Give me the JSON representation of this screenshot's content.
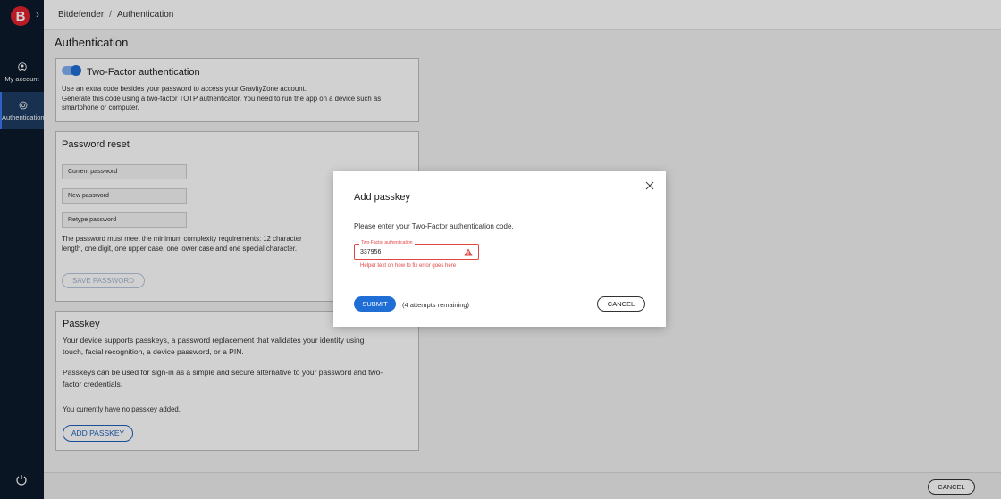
{
  "sidebar": {
    "logo_letter": "B",
    "items": [
      {
        "label": "My account",
        "icon": "user-circle-icon"
      },
      {
        "label": "Authentication",
        "icon": "target-icon"
      }
    ]
  },
  "breadcrumb": {
    "root": "Bitdefender",
    "separator": "/",
    "current": "Authentication"
  },
  "page_title": "Authentication",
  "two_factor": {
    "title": "Two-Factor authentication",
    "enabled": true,
    "line1": "Use an extra code besides your password to access your GravityZone account.",
    "line2": "Generate this code using a two-factor TOTP authenticator. You need to run the app on a device such as",
    "line3": "smartphone or computer."
  },
  "password_reset": {
    "title": "Password reset",
    "current_placeholder": "Current password",
    "new_placeholder": "New password",
    "retype_placeholder": "Retype password",
    "req1": "The password must meet the minimum complexity requirements: 12 character",
    "req2": "length, one digit, one upper case, one lower case and one special character.",
    "save_label": "SAVE PASSWORD"
  },
  "passkey": {
    "title": "Passkey",
    "p1a": "Your device supports passkeys, a password replacement that validates your identity using",
    "p1b": "touch, facial recognition, a device password, or a PIN.",
    "p2a": "Passkeys can be used for sign-in as a simple and secure alternative to your password and two-",
    "p2b": "factor credentials.",
    "status": "You currently have no passkey added.",
    "add_label": "ADD PASSKEY"
  },
  "footer": {
    "cancel_label": "CANCEL"
  },
  "modal": {
    "title": "Add passkey",
    "prompt": "Please enter your Two-Factor authentication code.",
    "field_label": "Two-Factor authentication",
    "field_value": "337956",
    "helper": "Helper text on how to fix error goes here",
    "submit_label": "SUBMIT",
    "attempts": "(4 attempts remaining)",
    "cancel_label": "CANCEL"
  },
  "colors": {
    "brand_red": "#e1222d",
    "accent_blue": "#1f6ed6",
    "error_red": "#e04545",
    "sidebar_bg": "#0d1a2b"
  }
}
